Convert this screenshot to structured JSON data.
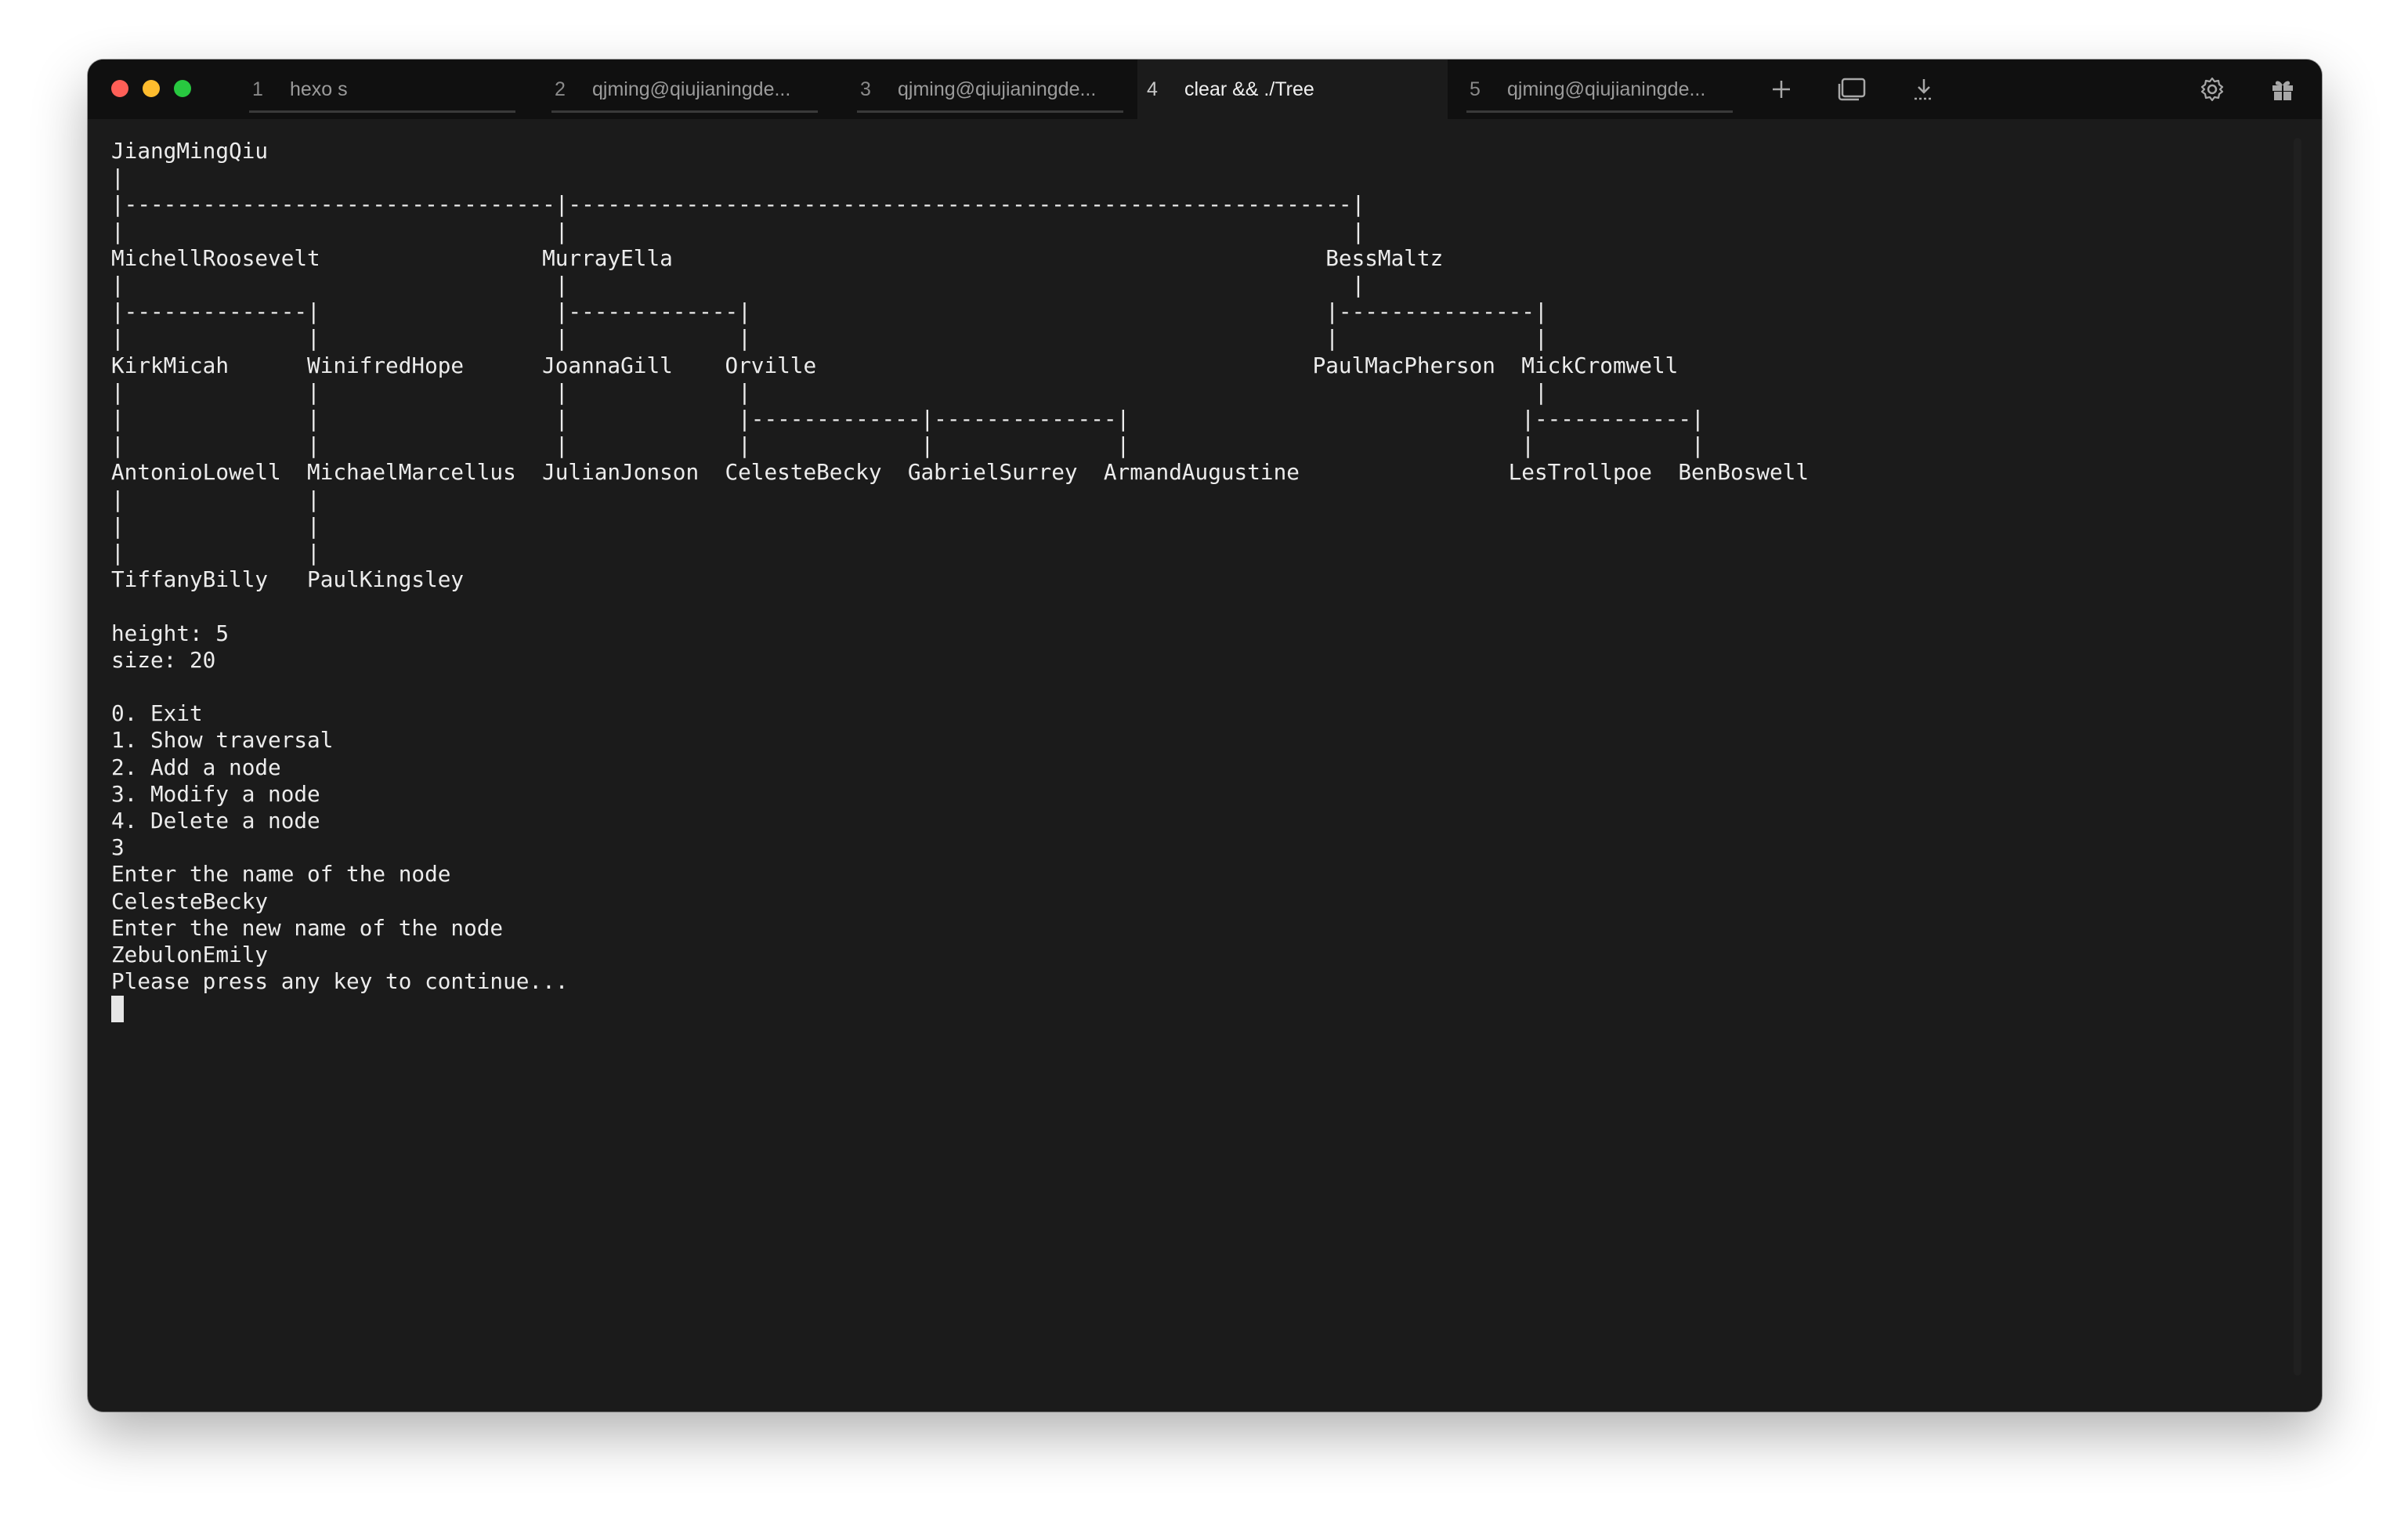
{
  "tabs": [
    {
      "number": "1",
      "title": "hexo s"
    },
    {
      "number": "2",
      "title": "qjming@qiujianingde..."
    },
    {
      "number": "3",
      "title": "qjming@qiujianingde..."
    },
    {
      "number": "4",
      "title": "clear && ./Tree"
    },
    {
      "number": "5",
      "title": "qjming@qiujianingde..."
    }
  ],
  "active_tab": "4",
  "toolbar": {
    "icons": [
      "plus-icon",
      "window-icon",
      "download-icon",
      "gear-icon",
      "gift-icon"
    ]
  },
  "terminal": {
    "lines": [
      "JiangMingQiu",
      "|",
      "|---------------------------------|------------------------------------------------------------|",
      "|                                 |                                                            |",
      "MichellRoosevelt                 MurrayElla                                                  BessMaltz",
      "|                                 |                                                            |",
      "|--------------|                  |-------------|                                            |---------------|",
      "|              |                  |             |                                            |               |",
      "KirkMicah      WinifredHope      JoannaGill    Orville                                      PaulMacPherson  MickCromwell",
      "|              |                  |             |                                                            |",
      "|              |                  |             |-------------|--------------|                              |------------|",
      "|              |                  |             |             |              |                              |            |",
      "AntonioLowell  MichaelMarcellus  JulianJonson  CelesteBecky  GabrielSurrey  ArmandAugustine                LesTrollpoe  BenBoswell",
      "|              |",
      "|              |",
      "|              |",
      "TiffanyBilly   PaulKingsley",
      "",
      "height: 5",
      "size: 20",
      "",
      "0. Exit",
      "1. Show traversal",
      "2. Add a node",
      "3. Modify a node",
      "4. Delete a node",
      "3",
      "Enter the name of the node",
      "CelesteBecky",
      "Enter the new name of the node",
      "ZebulonEmily",
      "Please press any key to continue..."
    ]
  }
}
